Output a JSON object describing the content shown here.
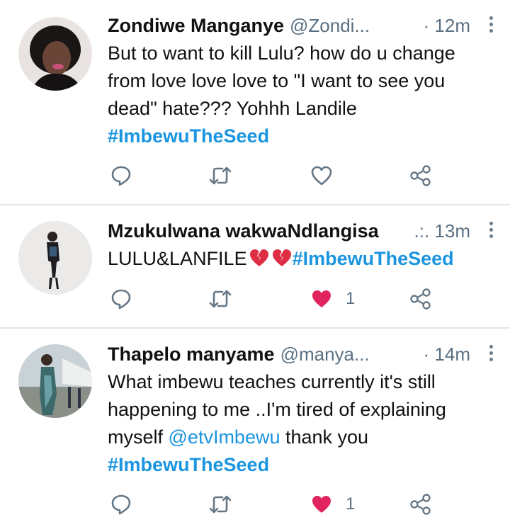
{
  "tweets": [
    {
      "name": "Zondiwe Manganye",
      "handle": "@Zondi...",
      "time": "· 12m",
      "body": "But to want to kill Lulu? how do u change from love love love to \"I want to see you dead\" hate??? Yohhh Landile",
      "hashtag": "#ImbewuTheSeed"
    },
    {
      "name": "Mzukulwana wakwaNdlangisa",
      "handle": "",
      "time": ".:. 13m",
      "body": "LULU&LANFILE",
      "hashtag": "#ImbewuTheSeed",
      "like_count": "1"
    },
    {
      "name": "Thapelo manyame",
      "handle": "@manya...",
      "time": "· 14m",
      "body_pre": "What imbewu teaches currently it's still happening to me ..I'm tired of explaining myself ",
      "mention": "@etvImbewu",
      "body_post": " thank you",
      "hashtag": "#ImbewuTheSeed",
      "like_count": "1"
    }
  ],
  "colors": {
    "accent": "#1b95e0",
    "like": "#e0245e",
    "icon": "#657786",
    "divider": "#e1e6ea"
  },
  "icons": [
    "reply-icon",
    "retweet-icon",
    "like-icon",
    "share-icon",
    "more-icon",
    "broken-heart-icon"
  ]
}
